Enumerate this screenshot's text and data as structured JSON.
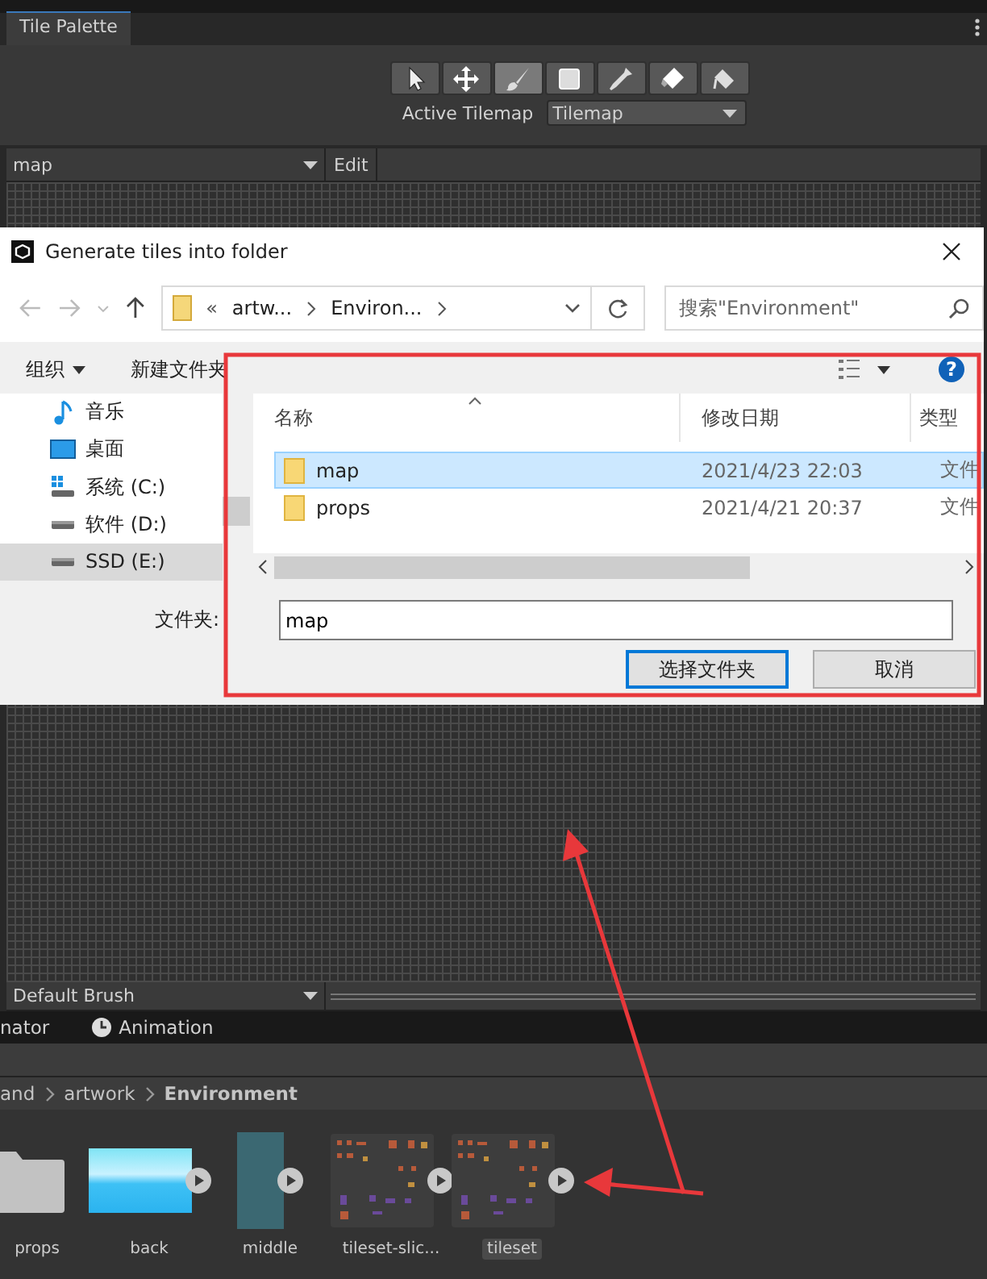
{
  "editor_tab": {
    "title": "Tile Palette"
  },
  "tools": [
    {
      "kind": "select",
      "selected": false
    },
    {
      "kind": "move",
      "selected": false
    },
    {
      "kind": "brush",
      "selected": true
    },
    {
      "kind": "box",
      "selected": false
    },
    {
      "kind": "picker",
      "selected": false
    },
    {
      "kind": "eraser",
      "selected": false
    },
    {
      "kind": "fill",
      "selected": false
    }
  ],
  "active_tilemap": {
    "label": "Active Tilemap",
    "value": "Tilemap"
  },
  "palette": {
    "value": "map",
    "edit": "Edit"
  },
  "dialog": {
    "title": "Generate tiles into folder",
    "address": [
      "artw...",
      "Environ..."
    ],
    "address_prefix": "«",
    "search": {
      "placeholder": "搜索\"Environment\""
    },
    "organize": "组织",
    "new_folder": "新建文件夹",
    "help": "?",
    "sidebar": [
      {
        "kind": "music",
        "label": "音乐",
        "selected": false
      },
      {
        "kind": "desktop",
        "label": "桌面",
        "selected": false
      },
      {
        "kind": "system-drive",
        "label": "系统 (C:)",
        "selected": false
      },
      {
        "kind": "drive",
        "label": "软件 (D:)",
        "selected": false
      },
      {
        "kind": "drive",
        "label": "SSD (E:)",
        "selected": true
      }
    ],
    "columns": [
      "名称",
      "修改日期",
      "类型"
    ],
    "rows": [
      {
        "name": "map",
        "date": "2021/4/23 22:03",
        "type": "文件",
        "selected": true
      },
      {
        "name": "props",
        "date": "2021/4/21 20:37",
        "type": "文件",
        "selected": false
      }
    ],
    "folder_label": "文件夹:",
    "folder_value": "map",
    "buttons": [
      {
        "label": "选择文件夹",
        "kind": "primary"
      },
      {
        "label": "取消",
        "kind": "normal"
      }
    ]
  },
  "brush": {
    "value": "Default Brush"
  },
  "bottom_tabs": [
    {
      "label": "nator",
      "kind": "plain"
    },
    {
      "label": "Animation",
      "kind": "clock"
    }
  ],
  "breadcrumb": [
    "and",
    "artwork",
    "Environment"
  ],
  "assets": [
    {
      "name": "props",
      "kind": "folder",
      "expandable": false,
      "selected": false
    },
    {
      "name": "back",
      "kind": "sky",
      "expandable": true,
      "selected": false
    },
    {
      "name": "middle",
      "kind": "tall",
      "expandable": true,
      "selected": false
    },
    {
      "name": "tileset-slic...",
      "kind": "sheet",
      "expandable": true,
      "selected": false
    },
    {
      "name": "tileset",
      "kind": "sheet",
      "expandable": true,
      "selected": true
    }
  ]
}
